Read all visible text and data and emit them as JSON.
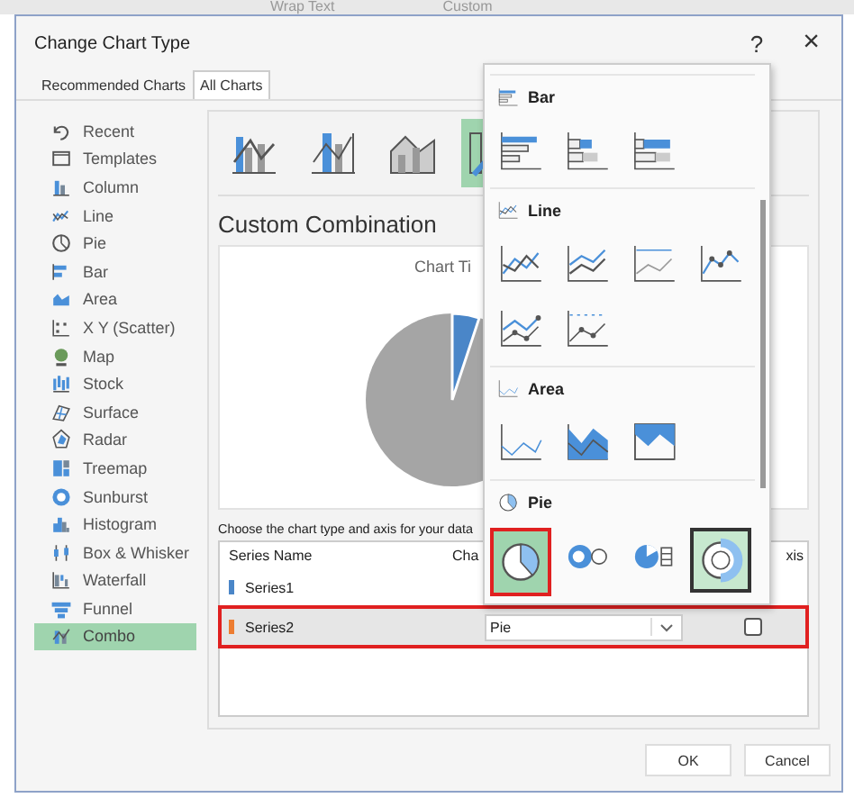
{
  "ribbon": {
    "items": [
      "Wrap Text",
      "Custom"
    ]
  },
  "window": {
    "title": "Change Chart Type",
    "help": "?",
    "close": "×"
  },
  "tabs": [
    {
      "label": "Recommended Charts",
      "selected": false
    },
    {
      "label": "All Charts",
      "selected": true
    }
  ],
  "sidebar": {
    "items": [
      {
        "label": "Recent",
        "selected": false
      },
      {
        "label": "Templates",
        "selected": false
      },
      {
        "label": "Column",
        "selected": false
      },
      {
        "label": "Line",
        "selected": false
      },
      {
        "label": "Pie",
        "selected": false
      },
      {
        "label": "Bar",
        "selected": false
      },
      {
        "label": "Area",
        "selected": false
      },
      {
        "label": "X Y (Scatter)",
        "selected": false
      },
      {
        "label": "Map",
        "selected": false
      },
      {
        "label": "Stock",
        "selected": false
      },
      {
        "label": "Surface",
        "selected": false
      },
      {
        "label": "Radar",
        "selected": false
      },
      {
        "label": "Treemap",
        "selected": false
      },
      {
        "label": "Sunburst",
        "selected": false
      },
      {
        "label": "Histogram",
        "selected": false
      },
      {
        "label": "Box & Whisker",
        "selected": false
      },
      {
        "label": "Waterfall",
        "selected": false
      },
      {
        "label": "Funnel",
        "selected": false
      },
      {
        "label": "Combo",
        "selected": true
      }
    ]
  },
  "subtypes": [
    {
      "selected": false
    },
    {
      "selected": false
    },
    {
      "selected": false
    },
    {
      "selected": true
    }
  ],
  "combination_title": "Custom Combination",
  "chart": {
    "title": "Chart Ti"
  },
  "instruction": "Choose the chart type and axis for your data",
  "series_table": {
    "columns": [
      "Series Name",
      "Cha",
      "xis"
    ],
    "rows": [
      {
        "name": "Series1",
        "color": "#4a86c8",
        "selected": false
      },
      {
        "name": "Series2",
        "color": "#ed7d31",
        "selected": true,
        "chart_type": "Pie",
        "secondary_axis": false
      }
    ]
  },
  "dropdown": {
    "sections": [
      {
        "kind": "bar",
        "title": "Bar",
        "options": [
          {
            "selected": false
          },
          {
            "selected": false
          },
          {
            "selected": false
          }
        ]
      },
      {
        "kind": "line",
        "title": "Line",
        "options": [
          {
            "selected": false
          },
          {
            "selected": false
          },
          {
            "selected": false
          },
          {
            "selected": false
          },
          {
            "selected": false
          },
          {
            "selected": false
          }
        ]
      },
      {
        "kind": "area",
        "title": "Area",
        "options": [
          {
            "selected": false
          },
          {
            "selected": false
          },
          {
            "selected": false
          }
        ]
      },
      {
        "kind": "pie",
        "title": "Pie",
        "options": [
          {
            "selected": true,
            "hovered": false
          },
          {
            "selected": false,
            "hovered": false
          },
          {
            "selected": false,
            "hovered": false
          },
          {
            "selected": false,
            "hovered": true
          }
        ]
      }
    ]
  },
  "buttons": [
    "OK",
    "Cancel"
  ]
}
